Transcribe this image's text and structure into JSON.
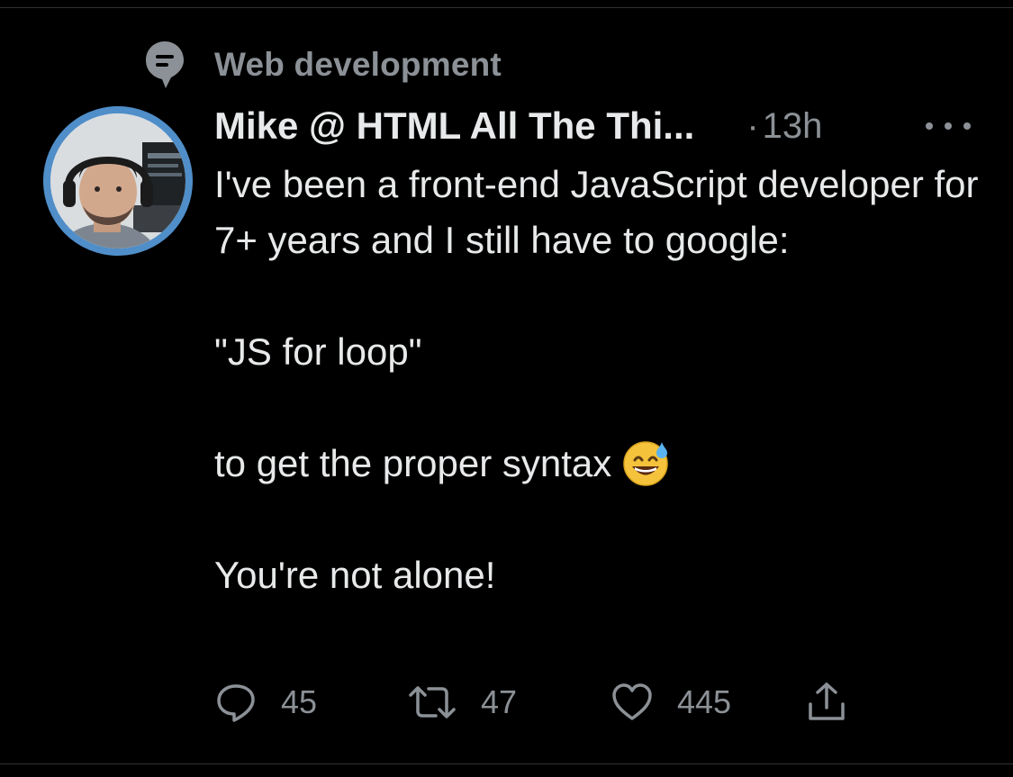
{
  "topic": {
    "label": "Web development",
    "icon": "topic-bubble-icon"
  },
  "tweet": {
    "author_name": "Mike @ HTML All The Thi...",
    "separator": "·",
    "time": "13h",
    "avatar": "avatar-photo",
    "avatar_ring_color": "#4f8ec9",
    "body": {
      "line1": "I've been a front-end JavaScript developer for 7+ years and I still have to google:",
      "line2": "\"JS for loop\"",
      "line3": "to get the proper syntax",
      "line3_emoji": "grinning-sweat-emoji",
      "line4": "You're not alone!"
    },
    "actions": {
      "reply_count": "45",
      "retweet_count": "47",
      "like_count": "445"
    }
  },
  "colors": {
    "background": "#000000",
    "primary_text": "#e7e9ea",
    "secondary_text": "#8b9196"
  }
}
